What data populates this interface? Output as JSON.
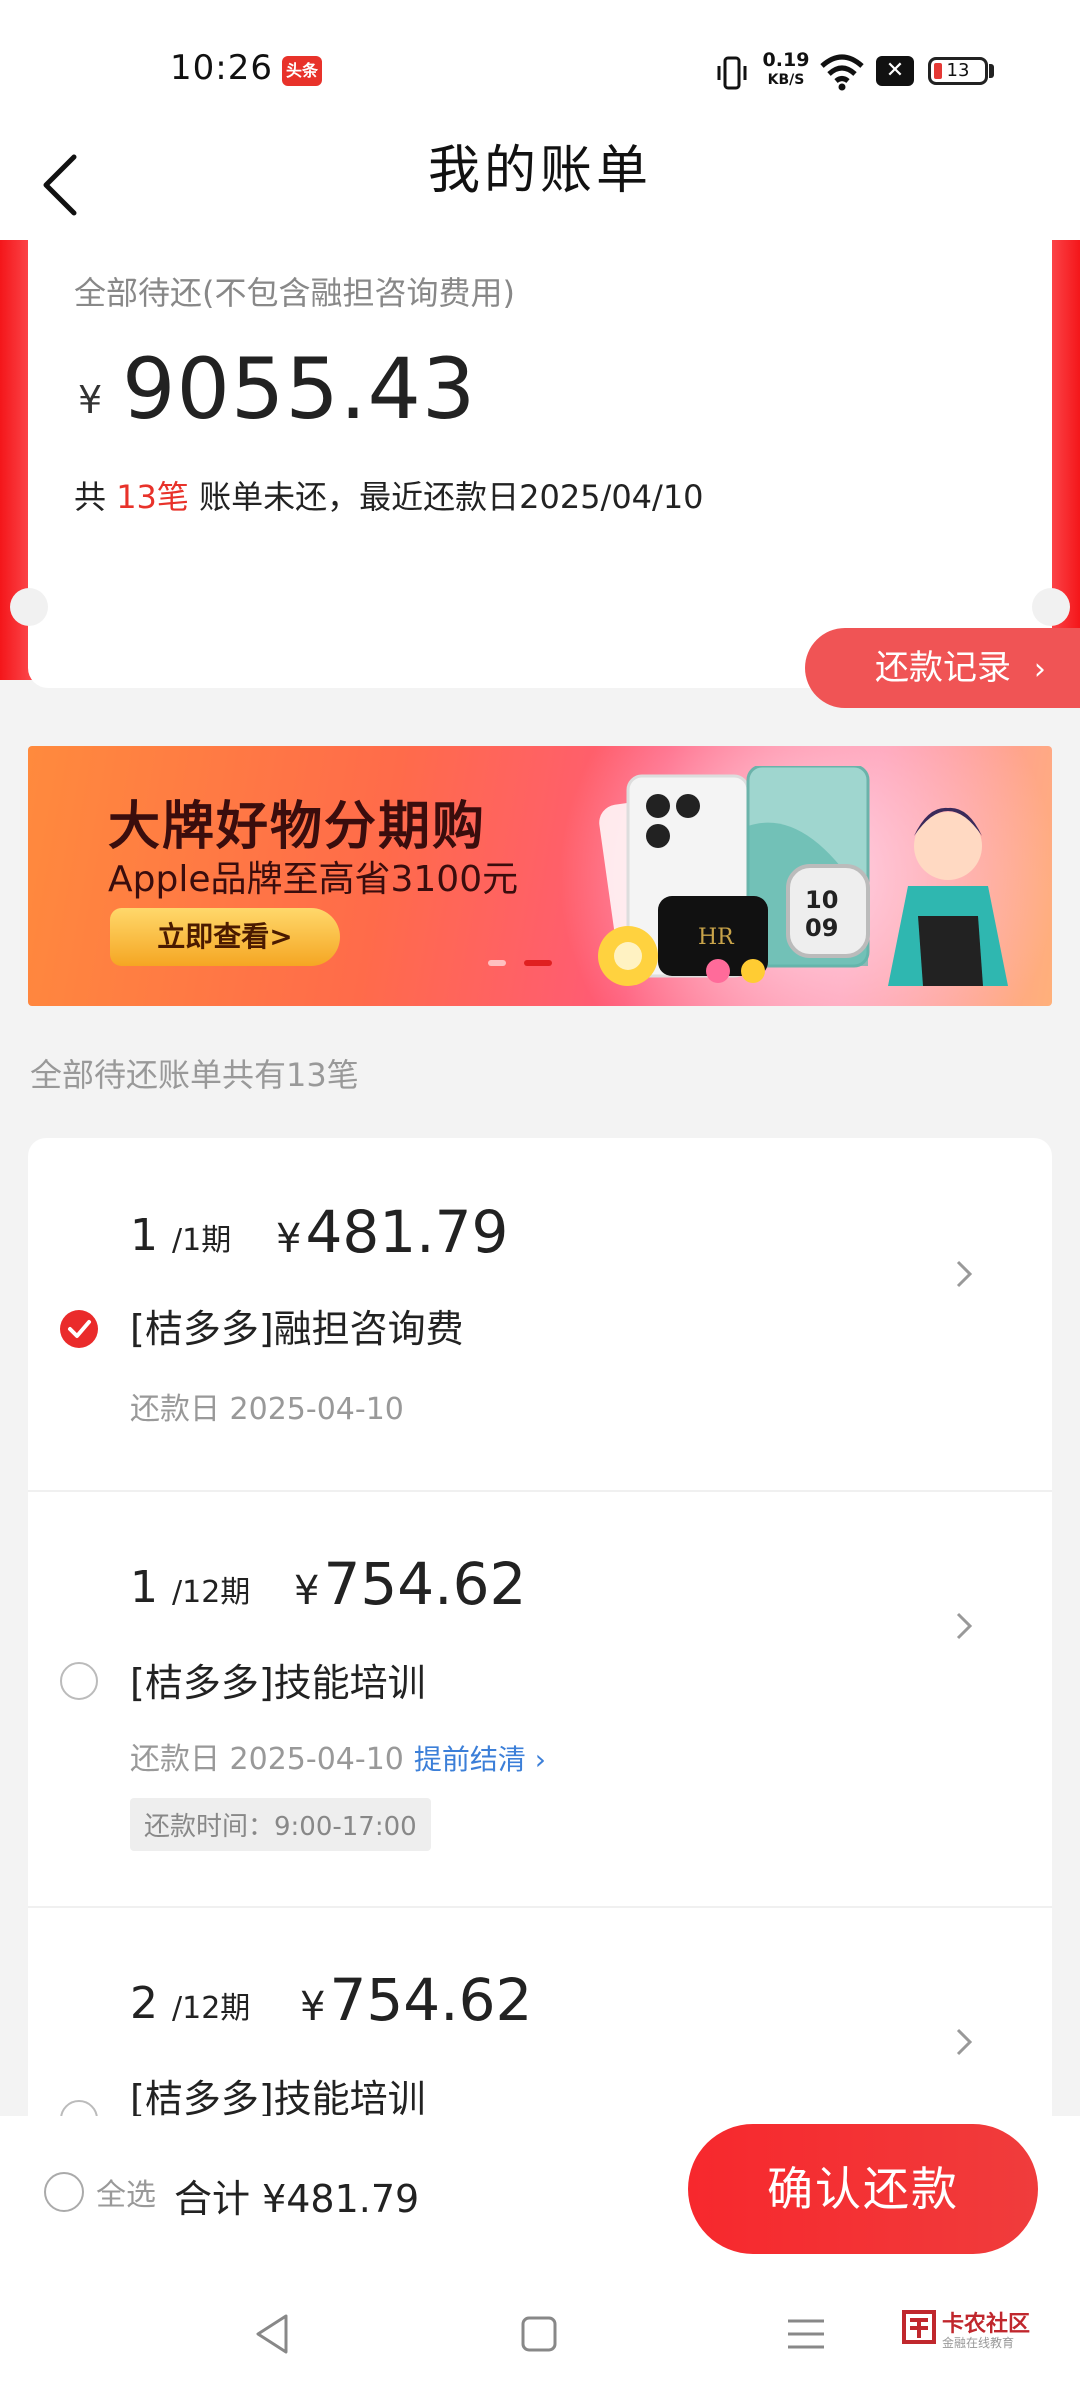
{
  "status_bar": {
    "time": "10:26",
    "news_badge": "头条",
    "net_speed": "0.19",
    "net_speed_unit": "KB/S",
    "battery": "13"
  },
  "header": {
    "title": "我的账单"
  },
  "summary": {
    "label": "全部待还(不包含融担咨询费用)",
    "currency": "¥",
    "amount": "9055.43",
    "bills_prefix": "共",
    "bills_count": "13笔",
    "bills_suffix": "账单未还，最近还款日2025/04/10",
    "record_button": "还款记录"
  },
  "banner": {
    "title": "大牌好物分期购",
    "subtitle": "Apple品牌至高省3100元",
    "button": "立即查看>"
  },
  "list_label": "全部待还账单共有13笔",
  "bills": [
    {
      "period": "1",
      "total": "/1期",
      "currency": "¥",
      "amount": "481.79",
      "name": "[桔多多]融担咨询费",
      "date_label": "还款日 2025-04-10",
      "checked": true
    },
    {
      "period": "1",
      "total": "/12期",
      "currency": "¥",
      "amount": "754.62",
      "name": "[桔多多]技能培训",
      "date_label": "还款日 2025-04-10",
      "early_payoff": "提前结清",
      "tag": "还款时间：9:00-17:00",
      "checked": false
    },
    {
      "period": "2",
      "total": "/12期",
      "currency": "¥",
      "amount": "754.62",
      "name": "[桔多多]技能培训",
      "checked": false
    }
  ],
  "footer": {
    "select_all": "全选",
    "total_label": "合计 ¥481.79",
    "confirm": "确认还款"
  },
  "watermark": {
    "title": "卡农社区",
    "subtitle": "金融在线教育"
  },
  "colors": {
    "accent": "#ea2b2b",
    "link": "#3c7fd8",
    "background": "#f3f3f3"
  }
}
